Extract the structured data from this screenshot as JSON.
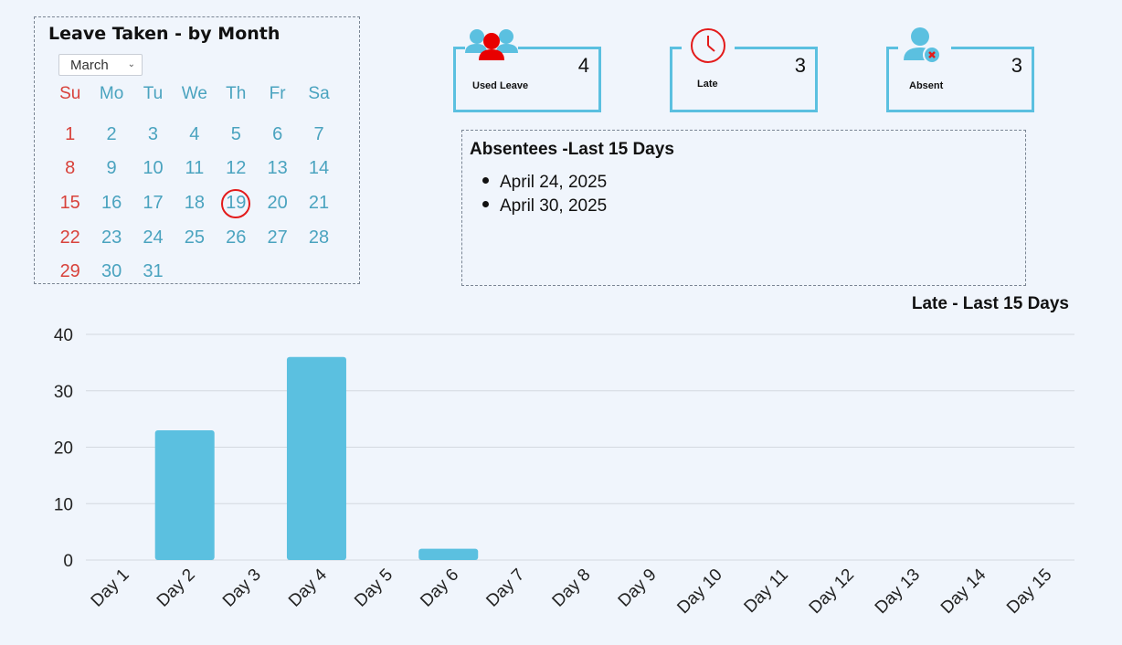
{
  "calendar": {
    "title": "Leave Taken - by Month",
    "month_select": "March",
    "weekdays": [
      "Su",
      "Mo",
      "Tu",
      "We",
      "Th",
      "Fr",
      "Sa"
    ],
    "days": [
      "1",
      "2",
      "3",
      "4",
      "5",
      "6",
      "7",
      "8",
      "9",
      "10",
      "11",
      "12",
      "13",
      "14",
      "15",
      "16",
      "17",
      "18",
      "19",
      "20",
      "21",
      "22",
      "23",
      "24",
      "25",
      "26",
      "27",
      "28",
      "29",
      "30",
      "31"
    ],
    "highlighted_day": "19"
  },
  "stats": {
    "used_leave": {
      "label": "Used Leave",
      "value": "4",
      "icon": "users-icon"
    },
    "late": {
      "label": "Late",
      "value": "3",
      "icon": "clock-icon"
    },
    "absent": {
      "label": "Absent",
      "value": "3",
      "icon": "user-x-icon"
    }
  },
  "absentees": {
    "title": "Absentees -Last 15 Days",
    "dates": [
      "April 24, 2025",
      "April 30, 2025"
    ]
  },
  "colors": {
    "accent": "#5bc0e0",
    "alert": "#e31b1b",
    "sunday": "#d8423b"
  },
  "chart_data": {
    "type": "bar",
    "title": "Late - Last 15 Days",
    "categories": [
      "Day 1",
      "Day 2",
      "Day 3",
      "Day 4",
      "Day 5",
      "Day 6",
      "Day 7",
      "Day 8",
      "Day 9",
      "Day 10",
      "Day 11",
      "Day 12",
      "Day 13",
      "Day 14",
      "Day 15"
    ],
    "values": [
      0,
      23,
      0,
      36,
      0,
      2,
      0,
      0,
      0,
      0,
      0,
      0,
      0,
      0,
      0
    ],
    "ylim": [
      0,
      40
    ],
    "yticks": [
      "0",
      "10",
      "20",
      "30",
      "40"
    ],
    "grid": true,
    "xlabel": "",
    "ylabel": ""
  }
}
